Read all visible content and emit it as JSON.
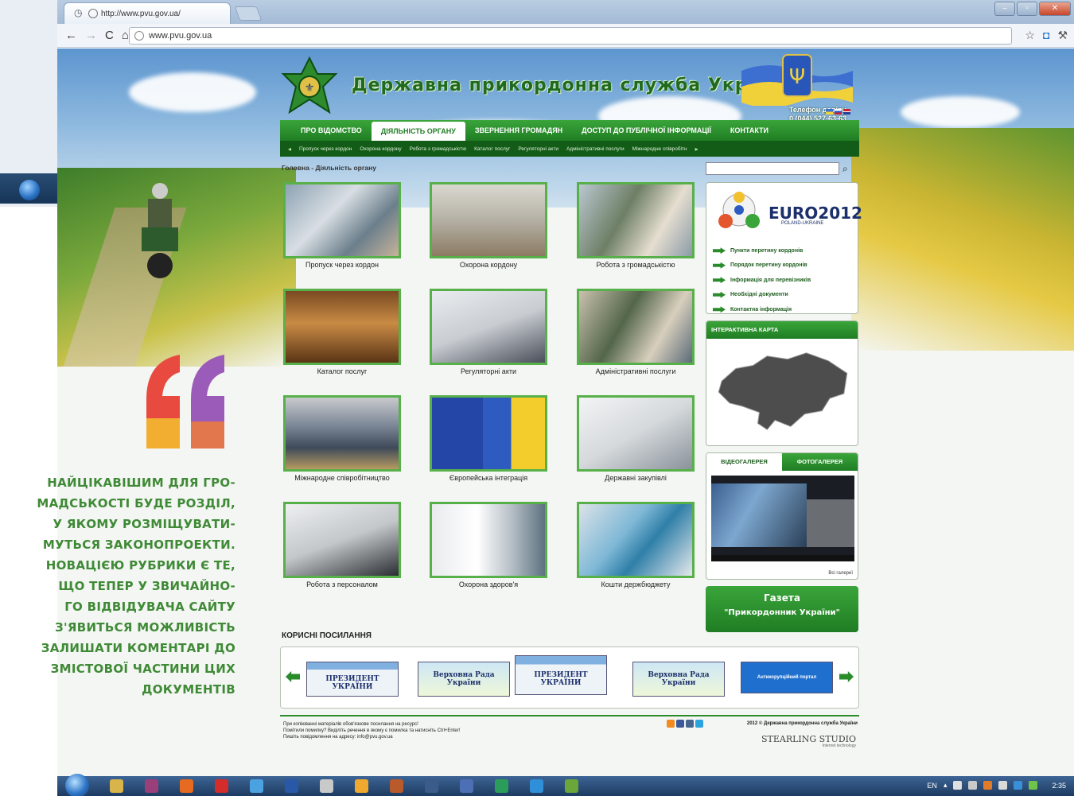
{
  "browser": {
    "tab_title": "http://www.pvu.gov.ua/",
    "url": "www.pvu.gov.ua"
  },
  "site": {
    "title": "Державна прикордонна служба України",
    "trust_label": "Телефон довіри",
    "trust_phone": "0 (044) 527-63-63",
    "main_nav": [
      "ПРО ВІДОМСТВО",
      "ДІЯЛЬНІСТЬ ОРГАНУ",
      "ЗВЕРНЕННЯ ГРОМАДЯН",
      "ДОСТУП ДО ПУБЛІЧНОЇ ІНФОРМАЦІЇ",
      "КОНТАКТИ"
    ],
    "main_nav_active": 1,
    "sub_nav": [
      "Пропуск через кордон",
      "Охорона кордону",
      "Робота з громадськістю",
      "Каталог послуг",
      "Регуляторні акти",
      "Адміністративні послуги",
      "Міжнародне співробітн"
    ],
    "breadcrumb": "Головна - Діяльність органу",
    "tiles": [
      "Пропуск через кордон",
      "Охорона кордону",
      "Робота з громадськістю",
      "Каталог послуг",
      "Регуляторні акти",
      "Адміністративні послуги",
      "Міжнародне співробітництво",
      "Європейська інтеграція",
      "Державні закупівлі",
      "Робота з персоналом",
      "Охорона здоров'я",
      "Кошти держбюджету"
    ],
    "euro": {
      "title": "EURO2012",
      "subtitle": "POLAND-UKRAINE",
      "links": [
        "Пункти перетину кордонів",
        "Порядок перетину кордонів",
        "Інформація для перевізників",
        "Необхідні документи",
        "Контактна інформація"
      ]
    },
    "map_title": "ІНТЕРАКТИВНА КАРТА",
    "gallery_tabs": [
      "ВІДЕОГАЛЕРЕЯ",
      "ФОТОГАЛЕРЕЯ"
    ],
    "gallery_all": "Всі галереї",
    "gazeta_line1": "Газета",
    "gazeta_line2": "\"Прикордонник України\"",
    "useful_title": "КОРИСНІ ПОСИЛАННЯ",
    "banners": [
      {
        "top": "PRESIDENT.GOV.UA",
        "text": "ПРЕЗИДЕНТ УКРАЇНИ"
      },
      {
        "top": "",
        "text": "Верховна Рада України"
      },
      {
        "top": "PRESIDENT.GOV.UA",
        "text": "ПРЕЗИДЕНТ УКРАЇНИ"
      },
      {
        "top": "",
        "text": "Верховна Рада України"
      },
      {
        "top": "",
        "text": "Антикорупційний портал"
      }
    ],
    "footer_lines": [
      "При копіюванні матеріалів обов'язкове посилання на ресурс!",
      "Помітили помилку? Виділіть речення в якому є помилка та натисніть Ctrl+Enter!",
      "Пишіть повідомлення на адресу: info@pvu.gov.ua"
    ],
    "footer_copyright": "2012 © Державна прикордонна служба України",
    "studio": "STEARLING STUDIO",
    "studio_sub": "Internet technology"
  },
  "article_text": "НАЙЦІКАВІШИМ ДЛЯ ГРО-\nМАДСЬКОСТІ БУДЕ РОЗДІЛ,\nУ ЯКОМУ РОЗМІЩУВАТИ-\nМУТЬСЯ ЗАКОНОПРОЕКТИ.\nНОВАЦІЄЮ РУБРИКИ Є ТЕ,\nЩО ТЕПЕР У ЗВИЧАЙНО-\nГО ВІДВІДУВАЧА САЙТУ\nЗ'ЯВИТЬСЯ МОЖЛИВІСТЬ\nЗАЛИШАТИ КОМЕНТАРІ ДО\nЗМІСТОВОЇ ЧАСТИНИ ЦИХ\nДОКУМЕНТІВ",
  "taskbar": {
    "lang": "EN",
    "clock": "2:35"
  },
  "colors": {
    "accent_green": "#1f7d23",
    "article_green": "#3f8a36"
  }
}
